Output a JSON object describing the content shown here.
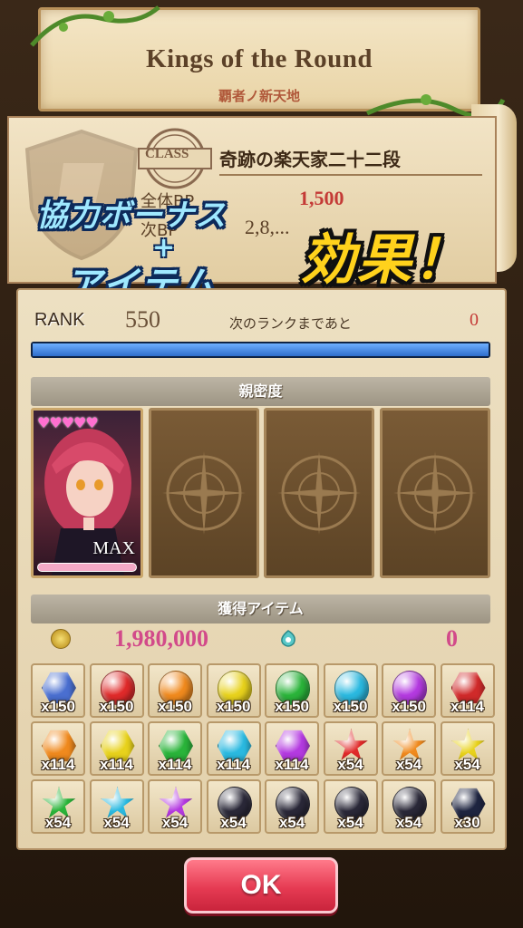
{
  "title": {
    "main": "Kings of the Round",
    "sub": "覇者ノ新天地"
  },
  "class_panel": {
    "badge": "CLASS",
    "name": "奇跡の楽天家二十二段",
    "bp_label": "全体BP",
    "bp_value": "1,500",
    "bp_label2": "次BP",
    "bp_value2": "2,8,..."
  },
  "promo": {
    "line1": "協力ボーナス",
    "plus": "+",
    "line2": "アイテム",
    "line3": "効果！"
  },
  "rank": {
    "label": "RANK",
    "value": "550",
    "next_label": "次のランクまであと",
    "next_value": "0",
    "progress": 1.0
  },
  "affection": {
    "header": "親密度",
    "hearts": "♥♥♥♥♥",
    "max_label": "MAX"
  },
  "items_section": {
    "header": "獲得アイテム",
    "coin_value": "1,980,000",
    "gem_value": "0"
  },
  "items": [
    {
      "shape": "hex",
      "color": "#4a6fd0",
      "count": "x150",
      "icon": "special-orb-icon"
    },
    {
      "shape": "gem",
      "color": "#e02a2a",
      "count": "x150",
      "icon": "red-gem-icon"
    },
    {
      "shape": "gem",
      "color": "#f08a1e",
      "count": "x150",
      "icon": "orange-gem-icon"
    },
    {
      "shape": "gem",
      "color": "#e8d21c",
      "count": "x150",
      "icon": "yellow-gem-icon"
    },
    {
      "shape": "gem",
      "color": "#2ab43a",
      "count": "x150",
      "icon": "green-gem-icon"
    },
    {
      "shape": "gem",
      "color": "#2ab9e0",
      "count": "x150",
      "icon": "blue-gem-icon"
    },
    {
      "shape": "gem",
      "color": "#b43ae0",
      "count": "x150",
      "icon": "purple-gem-icon"
    },
    {
      "shape": "hex",
      "color": "#d02a2a",
      "count": "x114",
      "icon": "red-hex-gem-icon"
    },
    {
      "shape": "hex",
      "color": "#f08a1e",
      "count": "x114",
      "icon": "orange-hex-gem-icon"
    },
    {
      "shape": "hex",
      "color": "#e8d21c",
      "count": "x114",
      "icon": "yellow-hex-gem-icon"
    },
    {
      "shape": "hex",
      "color": "#2ab43a",
      "count": "x114",
      "icon": "green-hex-gem-icon"
    },
    {
      "shape": "hex",
      "color": "#2ab9e0",
      "count": "x114",
      "icon": "blue-hex-gem-icon"
    },
    {
      "shape": "hex",
      "color": "#b43ae0",
      "count": "x114",
      "icon": "purple-hex-gem-icon"
    },
    {
      "shape": "star",
      "color": "#e02a2a",
      "count": "x54",
      "icon": "red-star-icon"
    },
    {
      "shape": "star",
      "color": "#f08a1e",
      "count": "x54",
      "icon": "orange-star-icon"
    },
    {
      "shape": "star",
      "color": "#e8d21c",
      "count": "x54",
      "icon": "yellow-star-icon"
    },
    {
      "shape": "star",
      "color": "#2ab43a",
      "count": "x54",
      "icon": "green-star-icon"
    },
    {
      "shape": "star",
      "color": "#2ab9e0",
      "count": "x54",
      "icon": "blue-star-icon"
    },
    {
      "shape": "star",
      "color": "#b43ae0",
      "count": "x54",
      "icon": "purple-star-icon"
    },
    {
      "shape": "orb",
      "color": "#2a2838",
      "count": "x54",
      "icon": "dark-orb-red-icon"
    },
    {
      "shape": "orb",
      "color": "#2a2838",
      "count": "x54",
      "icon": "dark-orb-yellow-icon"
    },
    {
      "shape": "orb",
      "color": "#2a2838",
      "count": "x54",
      "icon": "dark-orb-purple-icon"
    },
    {
      "shape": "orb",
      "color": "#2a2838",
      "count": "x54",
      "icon": "dark-orb-violet-icon"
    },
    {
      "shape": "hex",
      "color": "#1e2440",
      "count": "x30",
      "icon": "dark-hex-sword-icon"
    }
  ],
  "ok_button": "OK"
}
